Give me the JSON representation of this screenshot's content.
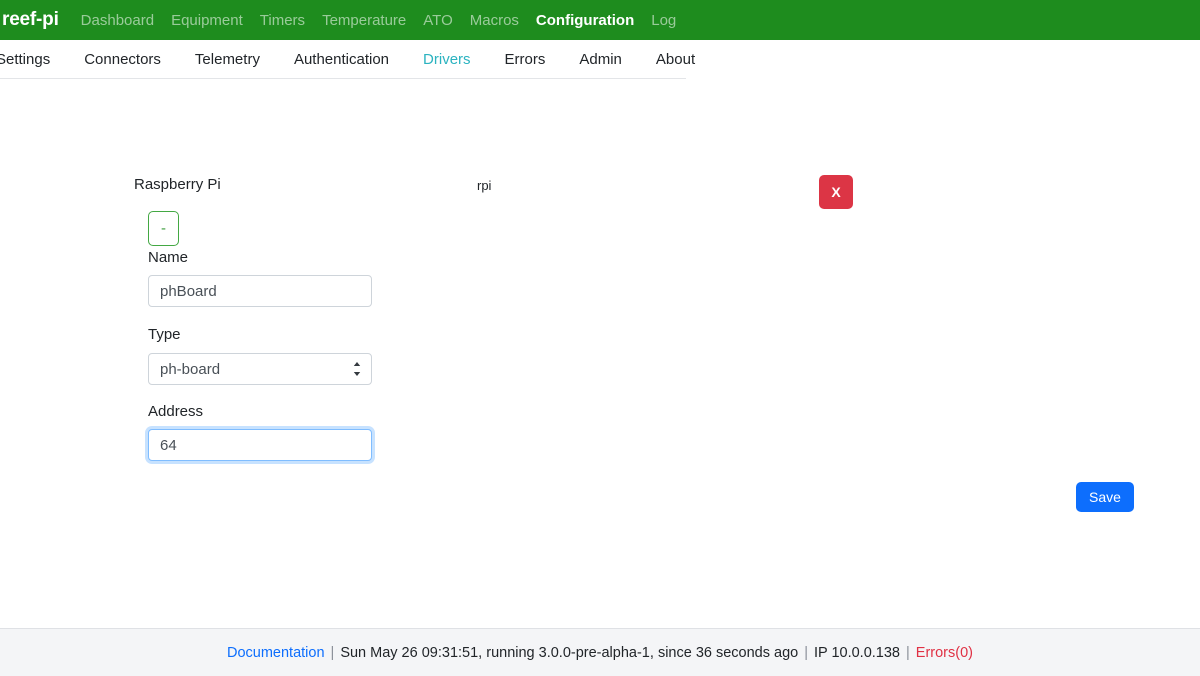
{
  "navbar": {
    "brand": "reef-pi",
    "items": [
      {
        "label": "Dashboard",
        "active": false
      },
      {
        "label": "Equipment",
        "active": false
      },
      {
        "label": "Timers",
        "active": false
      },
      {
        "label": "Temperature",
        "active": false
      },
      {
        "label": "ATO",
        "active": false
      },
      {
        "label": "Macros",
        "active": false
      },
      {
        "label": "Configuration",
        "active": true
      },
      {
        "label": "Log",
        "active": false
      }
    ],
    "background_color": "#1e8c1e"
  },
  "tabs": [
    {
      "label": "Settings",
      "active": false
    },
    {
      "label": "Connectors",
      "active": false
    },
    {
      "label": "Telemetry",
      "active": false
    },
    {
      "label": "Authentication",
      "active": false
    },
    {
      "label": "Drivers",
      "active": true
    },
    {
      "label": "Errors",
      "active": false
    },
    {
      "label": "Admin",
      "active": false
    },
    {
      "label": "About",
      "active": false
    }
  ],
  "tab_active_color": "#2bb3c0",
  "driver": {
    "title": "Raspberry Pi",
    "id": "rpi",
    "delete_label": "X",
    "delete_color": "#dc3545",
    "collapse_label": "-",
    "collapse_border_color": "#43a843",
    "fields": {
      "name_label": "Name",
      "name_value": "phBoard",
      "name_placeholder": "Name",
      "type_label": "Type",
      "type_value": "ph-board",
      "type_options": [
        "ph-board"
      ],
      "address_label": "Address",
      "address_value": "64",
      "address_placeholder": "Address",
      "address_focused": true,
      "focus_border_color": "#80bdff"
    }
  },
  "actions": {
    "save_label": "Save",
    "save_color": "#0d6efd"
  },
  "footer": {
    "documentation_label": "Documentation",
    "separator": "|",
    "timestamp": "Sun May 26 09:31:51,",
    "version": "running 3.0.0-pre-alpha-1,",
    "uptime": "since 36 seconds ago",
    "ip": "IP 10.0.0.138",
    "errors": "Errors(0)",
    "errors_color": "#e03144",
    "link_color": "#0d6efd"
  }
}
